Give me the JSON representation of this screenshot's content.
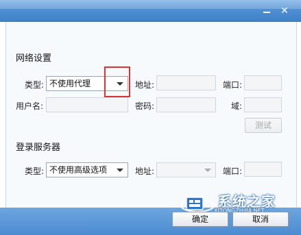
{
  "network": {
    "title": "网络设置",
    "type_label": "类型:",
    "type_value": "不使用代理",
    "address_label": "地址:",
    "port_label": "端口:",
    "username_label": "用户名:",
    "password_label": "密码:",
    "domain_label": "域:",
    "test_button": "测试"
  },
  "login_server": {
    "title": "登录服务器",
    "type_label": "类型:",
    "type_value": "不使用高级选项",
    "address_label": "地址:",
    "port_label": "端口:"
  },
  "footer": {
    "ok_button": "确定",
    "cancel_button": "取消"
  },
  "watermark": {
    "text": "系统之家",
    "sub": "XITONGZHIJIA.NET"
  },
  "colors": {
    "titlebar": "#4f8fd3",
    "highlight_box": "#e03030"
  }
}
